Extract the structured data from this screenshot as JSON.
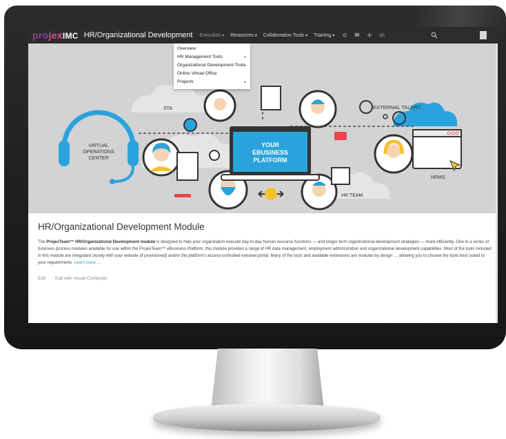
{
  "navbar": {
    "logo_pro": "pro",
    "logo_jex": "jex",
    "logo_imc": "IMC",
    "title": "HR/Organizational Development",
    "menu": [
      {
        "label": "Execution",
        "caret": "▾"
      },
      {
        "label": "Resources",
        "caret": "▾"
      },
      {
        "label": "Collaboration Tools",
        "caret": "▾"
      },
      {
        "label": "Training",
        "caret": "▾"
      }
    ],
    "icons": [
      "settings-icon",
      "chat-icon",
      "plus-icon",
      "eye-icon",
      "search-icon",
      "user-icon"
    ]
  },
  "dropdown": {
    "items": [
      {
        "label": "Overview",
        "has_submenu": false
      },
      {
        "label": "HR Management Tools",
        "has_submenu": true
      },
      {
        "label": "Organizational Development Tools",
        "has_submenu": true
      },
      {
        "label": "Online Virtual Office",
        "has_submenu": false
      },
      {
        "label": "Projects",
        "has_submenu": true
      }
    ],
    "arrow": "▸"
  },
  "hero": {
    "labels": {
      "virtual_ops_1": "VIRTUAL",
      "virtual_ops_2": "OPERATIONS",
      "virtual_ops_3": "CENTER",
      "platform_1": "YOUR",
      "platform_2": "EBUSINESS",
      "platform_3": "PLATFORM",
      "external_talent": "EXTERNAL TALENT",
      "hrms": "HRMS",
      "hr_team": "HR TEAM",
      "staff_partial": "STA"
    },
    "colors": {
      "background": "#d2d3d5",
      "accent_blue": "#2aa3dc",
      "accent_red": "#e8474e",
      "dark": "#333333",
      "yellow": "#f5c22b"
    }
  },
  "content": {
    "title": "HR/Organizational Development Module",
    "para_1": "The ",
    "para_bold": "ProjexTeam™ HR/Organizational Development module",
    "para_2": " is designed to help your organization execute day-to-day human resource functions — and longer term organizational development strategies — more efficiently. One in a series of business process modules available for use within the ProjexTeam™ eBusiness Platform, this module provides a range of HR data management, employment administration and organizational development capabilities. Most of the tools included in this module are integrated closely with your website (if provisioned) and/or the platform's access-controlled extranet portal. Many of the tools and available extensions are modular by design … allowing you to choose the tools best suited to your requirements. ",
    "learn_more": "Learn more …",
    "edit": "Edit",
    "edit_visual": "Edit with Visual Composer"
  }
}
